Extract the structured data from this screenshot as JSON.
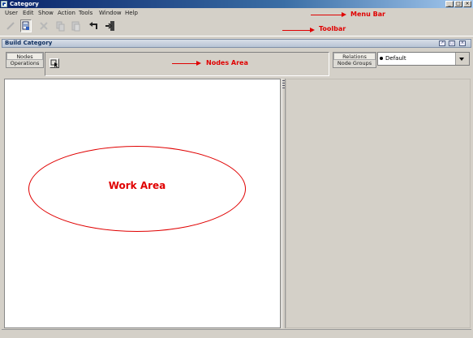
{
  "window": {
    "title": "Category",
    "buttons": {
      "minimize": "_",
      "maximize": "□",
      "close": "×"
    }
  },
  "menu": [
    "User",
    "Edit",
    "Show",
    "Action",
    "Tools",
    "Window",
    "Help"
  ],
  "toolbar": {
    "buttons": [
      "pencil-icon",
      "properties-icon",
      "delete-icon",
      "copy-icon",
      "paste-icon",
      "undo-icon",
      "exit-icon"
    ],
    "active": "properties-icon"
  },
  "annotations": {
    "menu_bar": "Menu Bar",
    "toolbar": "Toolbar",
    "nodes_area": "Nodes Area",
    "work_area": "Work Area",
    "color": "#e00000"
  },
  "panel": {
    "title": "Build Category",
    "left_tabs": [
      "Nodes",
      "Operations"
    ],
    "right_tabs": [
      "Relations",
      "Node Groups"
    ],
    "combo_value": "Default"
  }
}
